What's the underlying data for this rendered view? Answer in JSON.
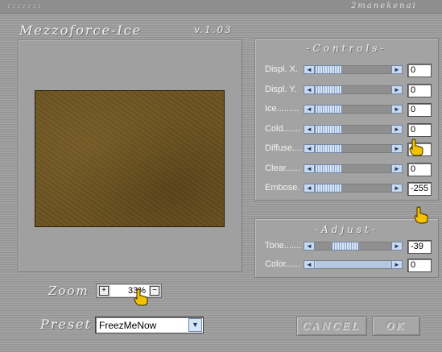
{
  "window": {
    "dots": ":::::::",
    "author": "2manekenai",
    "title": "Mezzoforce-Ice",
    "version": "v.1.03"
  },
  "controls": {
    "title": "-Controls-",
    "rows": [
      {
        "label": "Displ. X.",
        "value": "0",
        "level": 0.0
      },
      {
        "label": "Displ. Y.",
        "value": "0",
        "level": 0.0
      },
      {
        "label": "Ice.........",
        "value": "0",
        "level": 0.0
      },
      {
        "label": "Cold.......",
        "value": "0",
        "level": 0.0
      },
      {
        "label": "Diffuse....",
        "value": "0",
        "level": 0.0
      },
      {
        "label": "Clear......",
        "value": "0",
        "level": 0.0
      },
      {
        "label": "Embose.",
        "value": "-255",
        "level": 0.0
      }
    ]
  },
  "adjust": {
    "title": "-Adjust-",
    "rows": [
      {
        "label": "Tone.......",
        "value": "-39",
        "level": 0.35
      },
      {
        "label": "Color......",
        "value": "0",
        "level": 1.0
      }
    ]
  },
  "zoom": {
    "label": "Zoom",
    "value": "33%",
    "plus": "+",
    "minus": "−"
  },
  "preset": {
    "label": "Preset",
    "value": "FreezMeNow"
  },
  "buttons": {
    "cancel": "CANCEL",
    "ok": "OK"
  },
  "colors": {
    "accent": "#c9d9ee",
    "preview": "#6b5220",
    "hand": "#f2c200"
  },
  "icons": {
    "slider_left": "chevron-left-icon",
    "slider_right": "chevron-right-icon",
    "dropdown": "chevron-down-icon",
    "cursor": "hand-pointer-icon"
  }
}
